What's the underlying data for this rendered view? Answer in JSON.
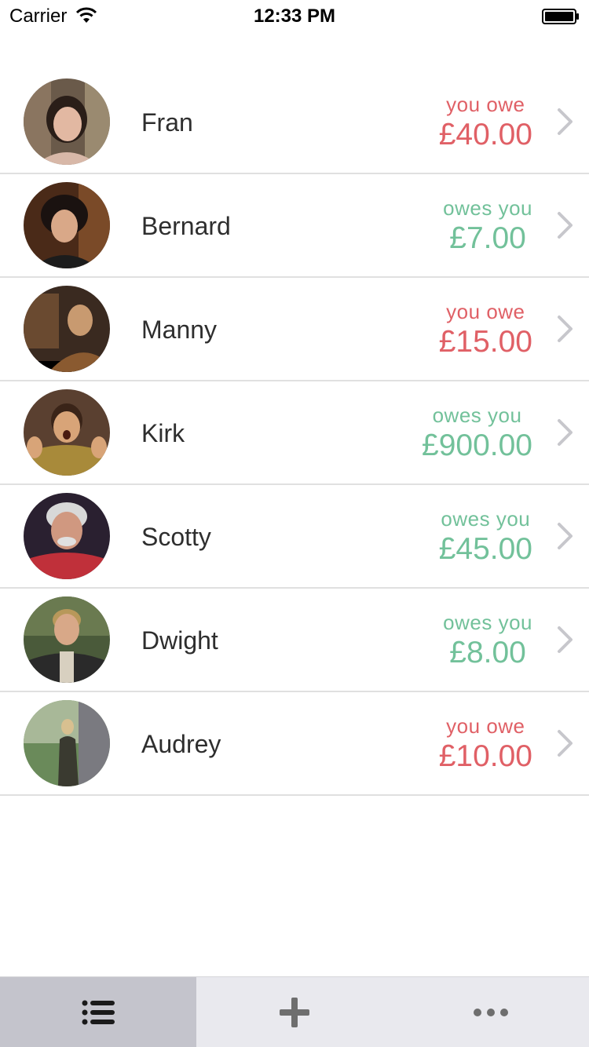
{
  "status_bar": {
    "carrier": "Carrier",
    "time": "12:33 PM"
  },
  "colors": {
    "you_owe": "#e06066",
    "owes_you": "#72c19a",
    "tab_active_bg": "#c4c4cc",
    "tab_bg": "#e9e9ee"
  },
  "rows": [
    {
      "name": "Fran",
      "status": "you owe",
      "amount": "£40.00",
      "direction": "owe"
    },
    {
      "name": "Bernard",
      "status": "owes you",
      "amount": "£7.00",
      "direction": "owed"
    },
    {
      "name": "Manny",
      "status": "you owe",
      "amount": "£15.00",
      "direction": "owe"
    },
    {
      "name": "Kirk",
      "status": "owes you",
      "amount": "£900.00",
      "direction": "owed"
    },
    {
      "name": "Scotty",
      "status": "owes you",
      "amount": "£45.00",
      "direction": "owed"
    },
    {
      "name": "Dwight",
      "status": "owes you",
      "amount": "£8.00",
      "direction": "owed"
    },
    {
      "name": "Audrey",
      "status": "you owe",
      "amount": "£10.00",
      "direction": "owe"
    }
  ],
  "tabs": [
    {
      "icon": "list-icon",
      "active": true
    },
    {
      "icon": "plus-icon",
      "active": false
    },
    {
      "icon": "more-icon",
      "active": false
    }
  ]
}
